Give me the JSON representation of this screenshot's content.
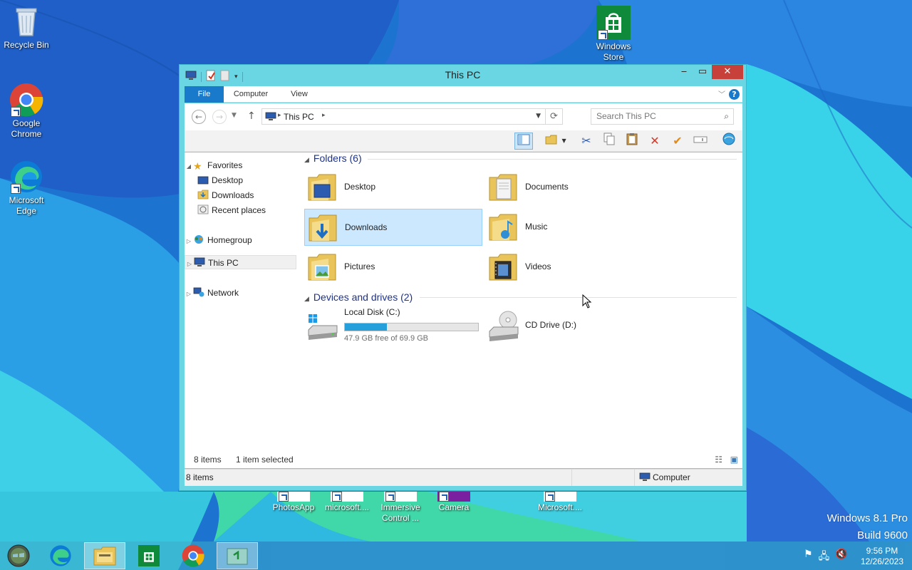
{
  "desktop": {
    "icons": [
      {
        "label": "Recycle Bin",
        "icon": "recycle-bin-icon"
      },
      {
        "label": "Google\nChrome",
        "icon": "chrome-icon"
      },
      {
        "label": "Microsoft\nEdge",
        "icon": "edge-icon"
      },
      {
        "label": "Windows\nStore",
        "icon": "store-icon"
      }
    ],
    "partial_icons": [
      "PhotosApp",
      "microsoft....",
      "Immersive\nControl ...",
      "Camera",
      "Microsoft...."
    ],
    "watermark": {
      "line1": "Windows 8.1 Pro",
      "line2": "Build 9600"
    }
  },
  "window": {
    "title": "This PC",
    "tabs": [
      "File",
      "Computer",
      "View"
    ],
    "address": {
      "crumb": "This PC"
    },
    "search": {
      "placeholder": "Search This PC"
    },
    "nav": {
      "favorites": "Favorites",
      "favorites_items": [
        "Desktop",
        "Downloads",
        "Recent places"
      ],
      "homegroup": "Homegroup",
      "this_pc": "This PC",
      "network": "Network"
    },
    "groups": {
      "folders": "Folders (6)",
      "devices": "Devices and drives (2)"
    },
    "folders": [
      {
        "label": "Desktop",
        "icon": "desktop-folder-icon"
      },
      {
        "label": "Documents",
        "icon": "documents-folder-icon"
      },
      {
        "label": "Downloads",
        "icon": "downloads-folder-icon",
        "selected": true
      },
      {
        "label": "Music",
        "icon": "music-folder-icon"
      },
      {
        "label": "Pictures",
        "icon": "pictures-folder-icon"
      },
      {
        "label": "Videos",
        "icon": "videos-folder-icon"
      }
    ],
    "drives": [
      {
        "label": "Local Disk (C:)",
        "free": "47.9 GB free of 69.9 GB",
        "used_fraction": 0.315
      },
      {
        "label": "CD Drive (D:)"
      }
    ],
    "status": {
      "count": "8 items",
      "selection": "1 item selected"
    },
    "details": {
      "count": "8 items",
      "location": "Computer"
    }
  },
  "taskbar": {
    "clock": {
      "time": "9:56 PM",
      "date": "12/26/2023"
    }
  },
  "colors": {
    "accent": "#1979ca",
    "title_bar": "#6ad6e3",
    "close": "#c7403a",
    "selection": "#cce8ff"
  }
}
